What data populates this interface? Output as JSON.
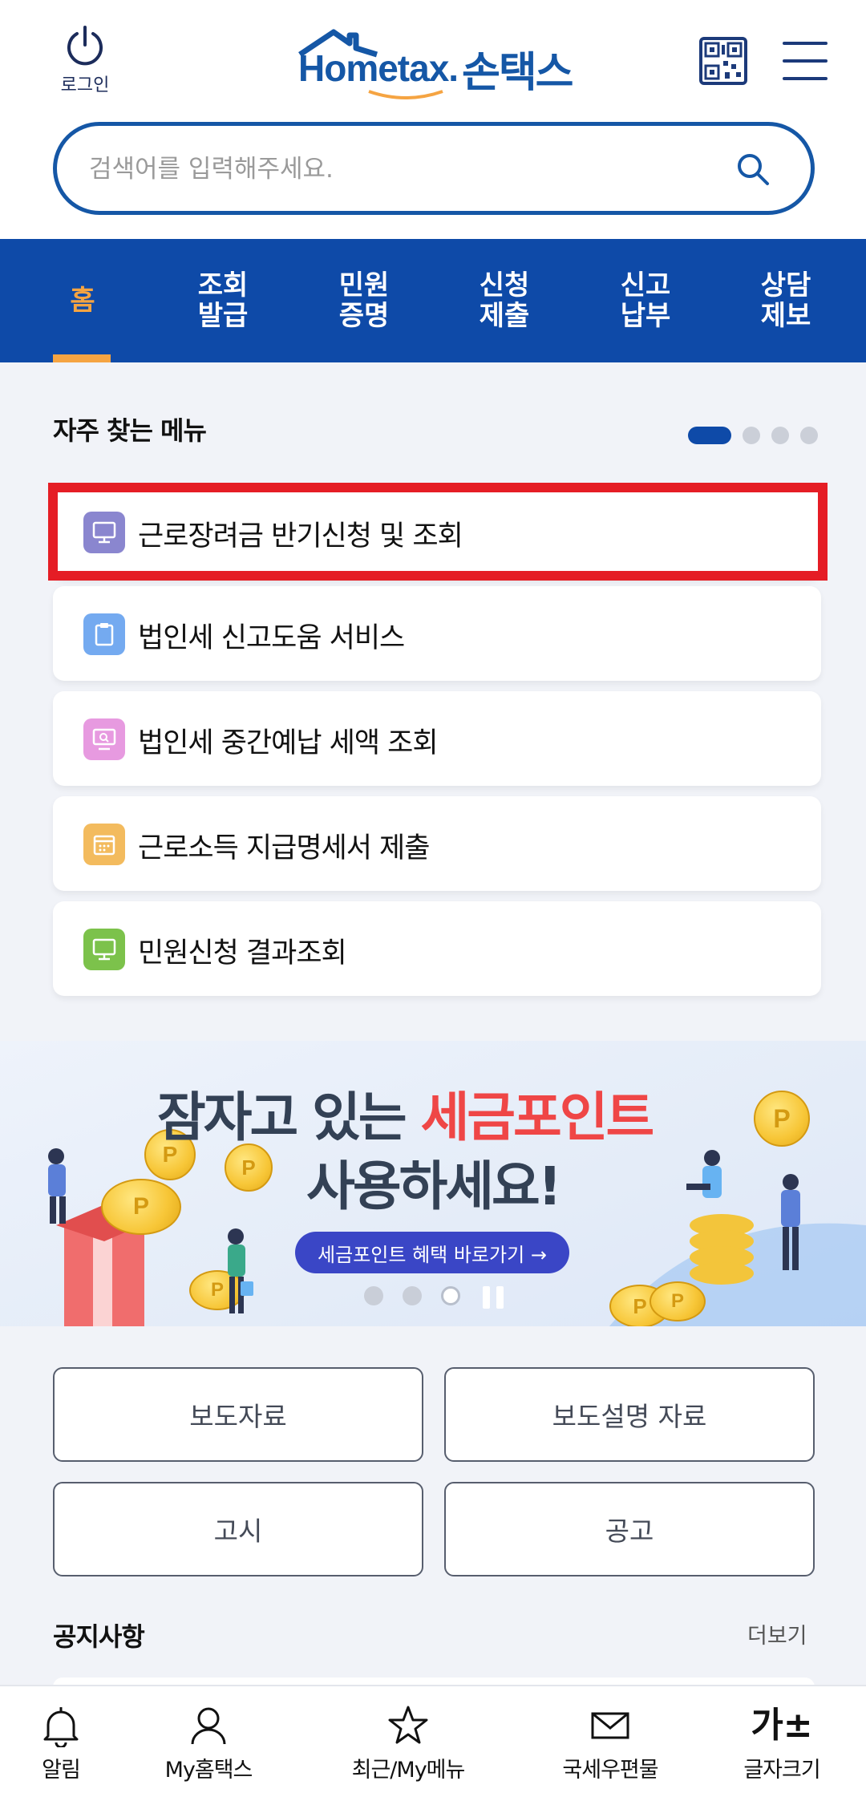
{
  "header": {
    "login_label": "로그인",
    "logo_en": "Hometax.",
    "logo_ko": "손택스"
  },
  "search": {
    "placeholder": "검색어를 입력해주세요."
  },
  "nav": {
    "active_index": 0,
    "items": [
      {
        "label": "홈"
      },
      {
        "label": "조회\n발급"
      },
      {
        "label": "민원\n증명"
      },
      {
        "label": "신청\n제출"
      },
      {
        "label": "신고\n납부"
      },
      {
        "label": "상담\n제보"
      }
    ]
  },
  "frequent": {
    "title": "자주 찾는 메뉴",
    "page_count": 4,
    "active_page": 0,
    "items": [
      {
        "label": "근로장려금 반기신청 및 조회",
        "icon": "monitor-icon",
        "color": "#8a86cf",
        "highlighted": true
      },
      {
        "label": "법인세 신고도움 서비스",
        "icon": "clipboard-icon",
        "color": "#74aaf0",
        "highlighted": false
      },
      {
        "label": "법인세 중간예납 세액 조회",
        "icon": "monitor-search-icon",
        "color": "#e79ae0",
        "highlighted": false
      },
      {
        "label": "근로소득 지급명세서 제출",
        "icon": "calendar-icon",
        "color": "#f3bb5e",
        "highlighted": false
      },
      {
        "label": "민원신청 결과조회",
        "icon": "monitor-icon",
        "color": "#7cc24b",
        "highlighted": false
      }
    ]
  },
  "banner": {
    "line1_prefix": "잠자고 있는 ",
    "line1_highlight": "세금포인트",
    "line2": "사용하세요!",
    "button_label": "세금포인트 혜택 바로가기 →",
    "slide_count": 3,
    "current_slide": 2,
    "highlight_color": "#ef4646"
  },
  "quick_links": [
    {
      "label": "보도자료"
    },
    {
      "label": "보도설명 자료"
    },
    {
      "label": "고시"
    },
    {
      "label": "공고"
    }
  ],
  "notice": {
    "title": "공지사항",
    "more_label": "더보기"
  },
  "bottom_tabs": [
    {
      "label": "알림",
      "icon": "bell-icon"
    },
    {
      "label": "My홈택스",
      "icon": "user-icon"
    },
    {
      "label": "최근/My메뉴",
      "icon": "star-icon"
    },
    {
      "label": "국세우편물",
      "icon": "mail-icon"
    },
    {
      "label": "글자크기",
      "icon": "font-size-icon",
      "glyph": "가±"
    }
  ],
  "colors": {
    "brand": "#0e4aa8",
    "accent": "#f5a442",
    "highlight_border": "#e51d25"
  }
}
